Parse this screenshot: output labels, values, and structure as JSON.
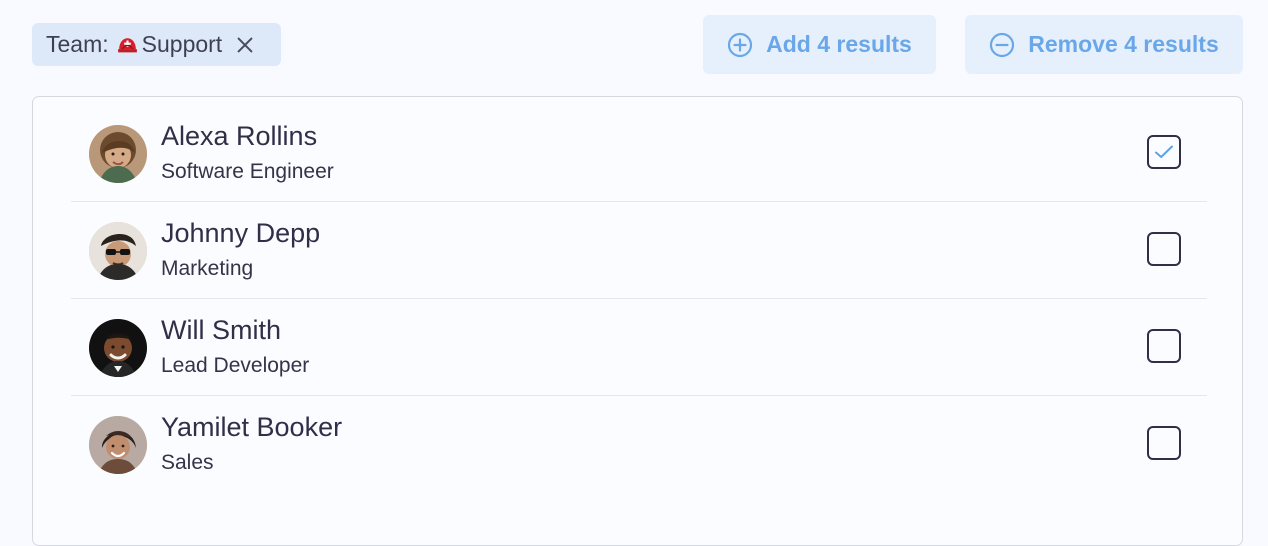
{
  "filter": {
    "label": "Team:",
    "value": "Support",
    "emoji_icon": "rescue-helmet-icon",
    "remove_icon": "close-icon"
  },
  "actions": {
    "add_label": "Add 4 results",
    "add_icon": "plus-circle-icon",
    "remove_label": "Remove 4 results",
    "remove_icon": "minus-circle-icon"
  },
  "colors": {
    "page_background": "#f8faff",
    "chip_background": "#dde9f8",
    "button_background": "#e6f0fc",
    "button_text": "#6aa7e8",
    "text_primary": "#2f2f48",
    "checkbox_border": "#2f2f48"
  },
  "people": [
    {
      "name": "Alexa Rollins",
      "role": "Software Engineer",
      "selected": true,
      "avatar_icon": "person-avatar-icon"
    },
    {
      "name": "Johnny Depp",
      "role": "Marketing",
      "selected": false,
      "avatar_icon": "person-avatar-icon"
    },
    {
      "name": "Will Smith",
      "role": "Lead Developer",
      "selected": false,
      "avatar_icon": "person-avatar-icon"
    },
    {
      "name": "Yamilet Booker",
      "role": "Sales",
      "selected": false,
      "avatar_icon": "person-avatar-icon"
    }
  ]
}
